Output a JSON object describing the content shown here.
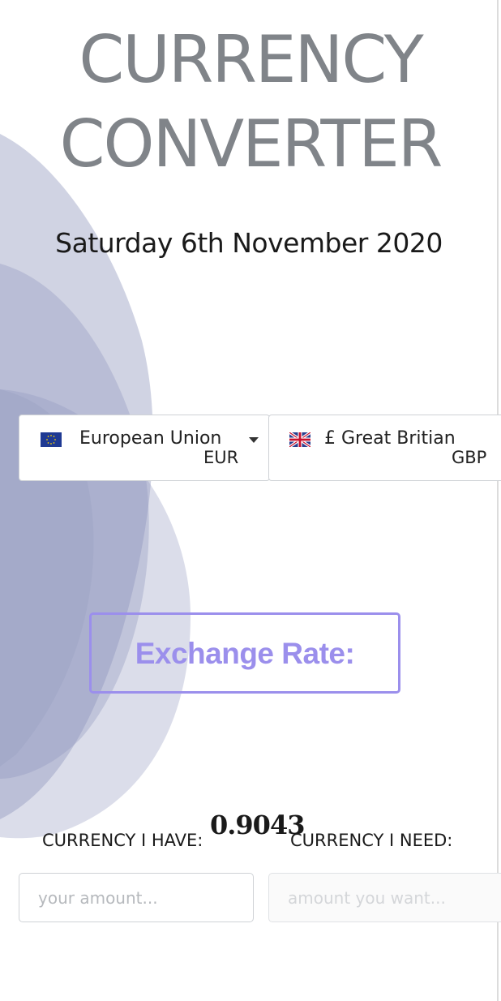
{
  "header": {
    "title_line1": "CURRENCY",
    "title_line2": "CONVERTER",
    "date": "Saturday 6th November 2020"
  },
  "colors": {
    "title": "#808489",
    "accent": "#9b8fec",
    "blob": "#8e96bd"
  },
  "from_currency": {
    "flag": "eu-flag-icon",
    "name": "European Union",
    "code": "EUR"
  },
  "to_currency": {
    "flag": "uk-flag-icon",
    "name": "£ Great Britian",
    "code": "GBP"
  },
  "exchange": {
    "button_label": "Exchange Rate:",
    "rate": "0.9043"
  },
  "amounts": {
    "have_label": "CURRENCY I HAVE:",
    "need_label": "CURRENCY I NEED:",
    "have_placeholder": "your amount...",
    "need_placeholder": "amount you want...",
    "have_value": "",
    "need_value": ""
  }
}
